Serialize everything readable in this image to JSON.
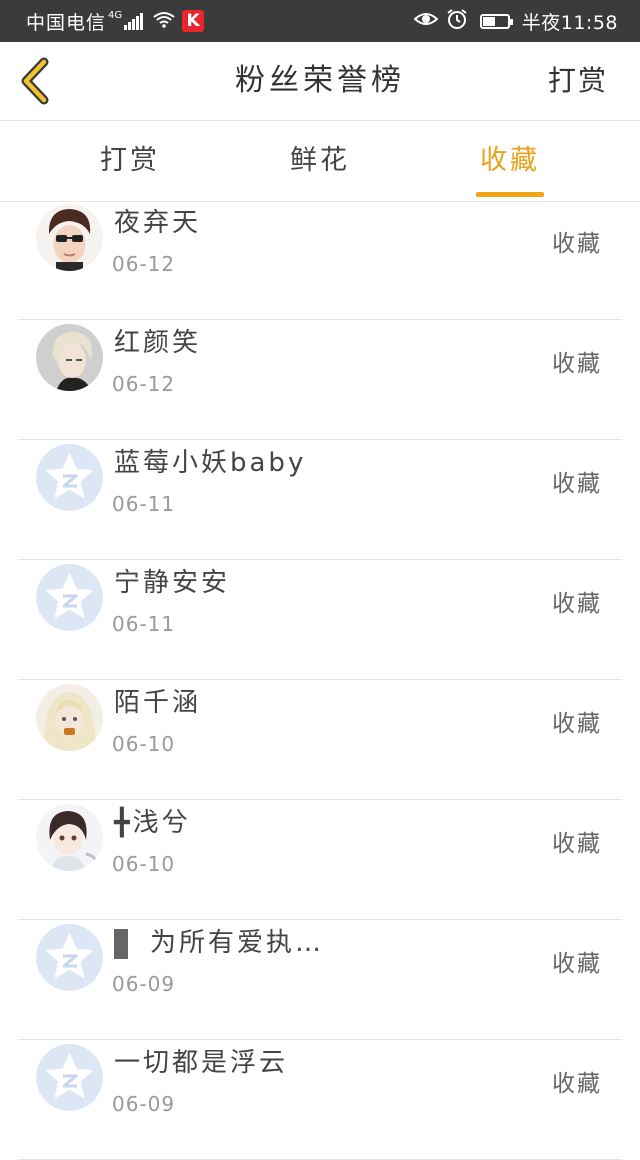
{
  "status_bar": {
    "carrier": "中国电信",
    "network": "4G",
    "time": "半夜11:58",
    "battery_level": 0.55,
    "app_icon_letter": "K",
    "icons": [
      "signal-icon",
      "wifi-icon",
      "k-app-icon",
      "eye-icon",
      "alarm-icon",
      "battery-icon"
    ]
  },
  "header": {
    "title": "粉丝荣誉榜",
    "action_label": "打赏",
    "back_icon": "chevron-left-icon"
  },
  "tabs": [
    {
      "label": "打赏",
      "active": false
    },
    {
      "label": "鲜花",
      "active": false
    },
    {
      "label": "收藏",
      "active": true
    }
  ],
  "colors": {
    "accent": "#f0a414",
    "status_bar": "#3b3b3b",
    "divider": "#e4e4e4",
    "default_avatar_bg": "#dce6f5"
  },
  "rows": [
    {
      "name": "夜弃天",
      "date": "06-12",
      "action": "收藏",
      "avatar": "photo-male-sunglasses"
    },
    {
      "name": "红颜笑",
      "date": "06-12",
      "action": "收藏",
      "avatar": "photo-blond-male"
    },
    {
      "name": "蓝莓小妖baby",
      "date": "06-11",
      "action": "收藏",
      "avatar": "default-star"
    },
    {
      "name": "宁静安安",
      "date": "06-11",
      "action": "收藏",
      "avatar": "default-star"
    },
    {
      "name": "陌千涵",
      "date": "06-10",
      "action": "收藏",
      "avatar": "photo-blond-girl"
    },
    {
      "name": "╋浅兮",
      "date": "06-10",
      "action": "收藏",
      "avatar": "photo-anime-boy"
    },
    {
      "name": "为所有爱执…",
      "date": "06-09",
      "action": "收藏",
      "avatar": "default-star"
    },
    {
      "name": "一切都是浮云",
      "date": "06-09",
      "action": "收藏",
      "avatar": "default-star"
    }
  ]
}
